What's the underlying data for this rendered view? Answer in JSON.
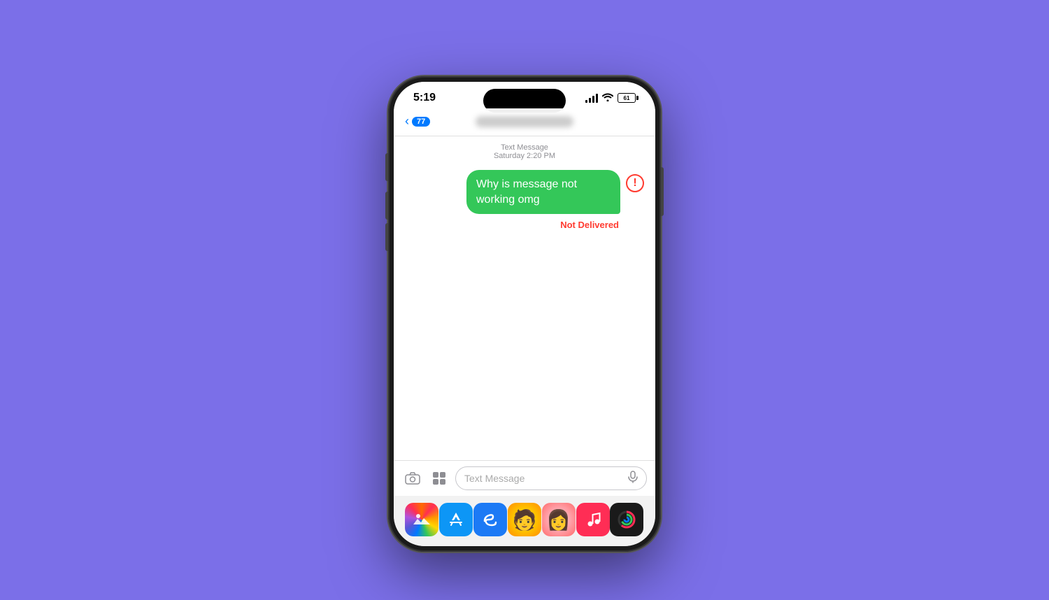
{
  "background": {
    "color": "#7B6FE8"
  },
  "status_bar": {
    "time": "5:19",
    "battery_level": "61",
    "signal_bars": [
      4,
      7,
      10,
      13
    ],
    "has_wifi": true
  },
  "nav_bar": {
    "back_badge": "77"
  },
  "messages": {
    "timestamp_label": "Text Message",
    "timestamp_sub": "Saturday 2:20 PM",
    "bubble_text": "Why is message not working omg",
    "not_delivered_text": "Not Delivered"
  },
  "input_bar": {
    "placeholder": "Text Message"
  },
  "dock": {
    "apps": [
      {
        "name": "Photos",
        "icon": "🌅"
      },
      {
        "name": "App Store",
        "icon": ""
      },
      {
        "name": "Shazam",
        "icon": ""
      },
      {
        "name": "Memoji 1",
        "icon": ""
      },
      {
        "name": "Memoji 2",
        "icon": ""
      },
      {
        "name": "Music",
        "icon": ""
      },
      {
        "name": "Activity",
        "icon": ""
      }
    ]
  }
}
